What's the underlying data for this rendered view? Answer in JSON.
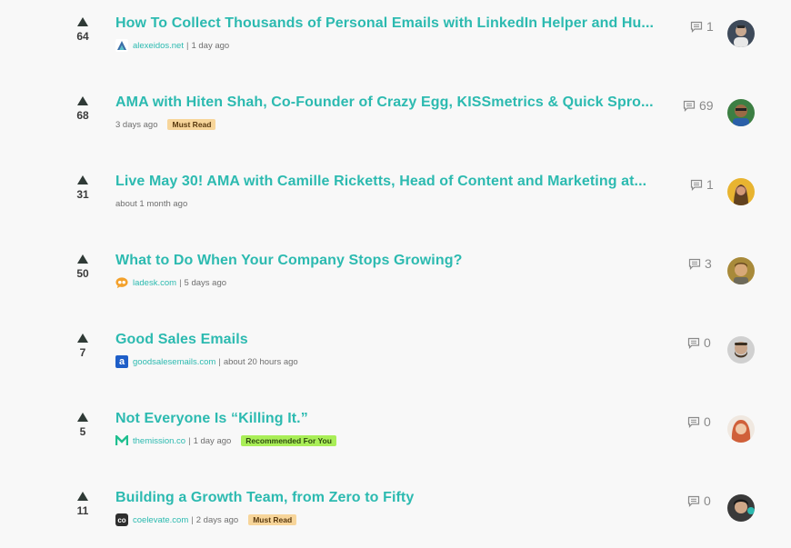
{
  "posts": [
    {
      "votes": "64",
      "title": "How To Collect Thousands of Personal Emails with LinkedIn Helper and Hu...",
      "source": "alexeidos.net",
      "time": "1 day ago",
      "badge": "",
      "comments": "1",
      "favicon_icon": "a-logo-icon"
    },
    {
      "votes": "68",
      "title": "AMA with Hiten Shah, Co-Founder of Crazy Egg, KISSmetrics & Quick Spro...",
      "source": "",
      "time": "3 days ago",
      "badge": "Must Read",
      "comments": "69",
      "favicon_icon": ""
    },
    {
      "votes": "31",
      "title": "Live May 30! AMA with Camille Ricketts, Head of Content and Marketing at...",
      "source": "",
      "time": "about 1 month ago",
      "badge": "",
      "comments": "1",
      "favicon_icon": ""
    },
    {
      "votes": "50",
      "title": "What to Do When Your Company Stops Growing?",
      "source": "ladesk.com",
      "time": "5 days ago",
      "badge": "",
      "comments": "3",
      "favicon_icon": "ladesk-icon"
    },
    {
      "votes": "7",
      "title": "Good Sales Emails",
      "source": "goodsalesemails.com",
      "time": "about 20 hours ago",
      "badge": "",
      "comments": "0",
      "favicon_icon": "a-letter-icon"
    },
    {
      "votes": "5",
      "title": "Not Everyone Is “Killing It.”",
      "source": "themission.co",
      "time": "1 day ago",
      "badge": "Recommended For You",
      "comments": "0",
      "favicon_icon": "m-logo-icon"
    },
    {
      "votes": "11",
      "title": "Building a Growth Team, from Zero to Fifty",
      "source": "coelevate.com",
      "time": "2 days ago",
      "badge": "Must Read",
      "comments": "0",
      "favicon_icon": "co-logo-icon"
    }
  ],
  "colors": {
    "title": "#2cbab0",
    "must_read_bg": "#f7d59a",
    "recommended_bg": "#a9ee57"
  }
}
